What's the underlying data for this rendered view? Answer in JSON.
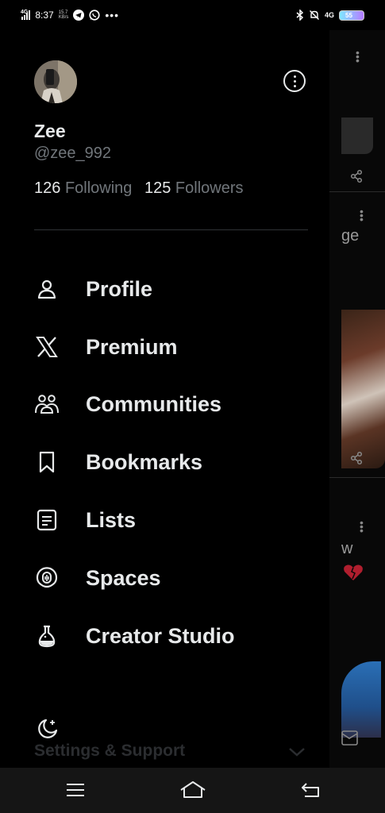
{
  "status_bar": {
    "network": "4G",
    "time": "8:37",
    "speed_top": "15.7",
    "speed_bottom": "KB/s",
    "network_right": "4G",
    "battery": "55"
  },
  "profile": {
    "name": "Zee",
    "handle": "@zee_992",
    "following_count": "126",
    "following_label": "Following",
    "followers_count": "125",
    "followers_label": "Followers"
  },
  "menu": [
    {
      "label": "Profile",
      "icon": "person-icon"
    },
    {
      "label": "Premium",
      "icon": "x-logo-icon"
    },
    {
      "label": "Communities",
      "icon": "communities-icon"
    },
    {
      "label": "Bookmarks",
      "icon": "bookmark-icon"
    },
    {
      "label": "Lists",
      "icon": "list-icon"
    },
    {
      "label": "Spaces",
      "icon": "spaces-icon"
    },
    {
      "label": "Creator Studio",
      "icon": "flask-icon"
    }
  ],
  "footer": {
    "settings_label": "Settings & Support"
  },
  "backdrop_peek": {
    "text_1": "ge",
    "text_2": "w"
  },
  "colors": {
    "background": "#000000",
    "primary_text": "#e7e9ea",
    "secondary_text": "#71767b",
    "divider": "#2f3336"
  }
}
